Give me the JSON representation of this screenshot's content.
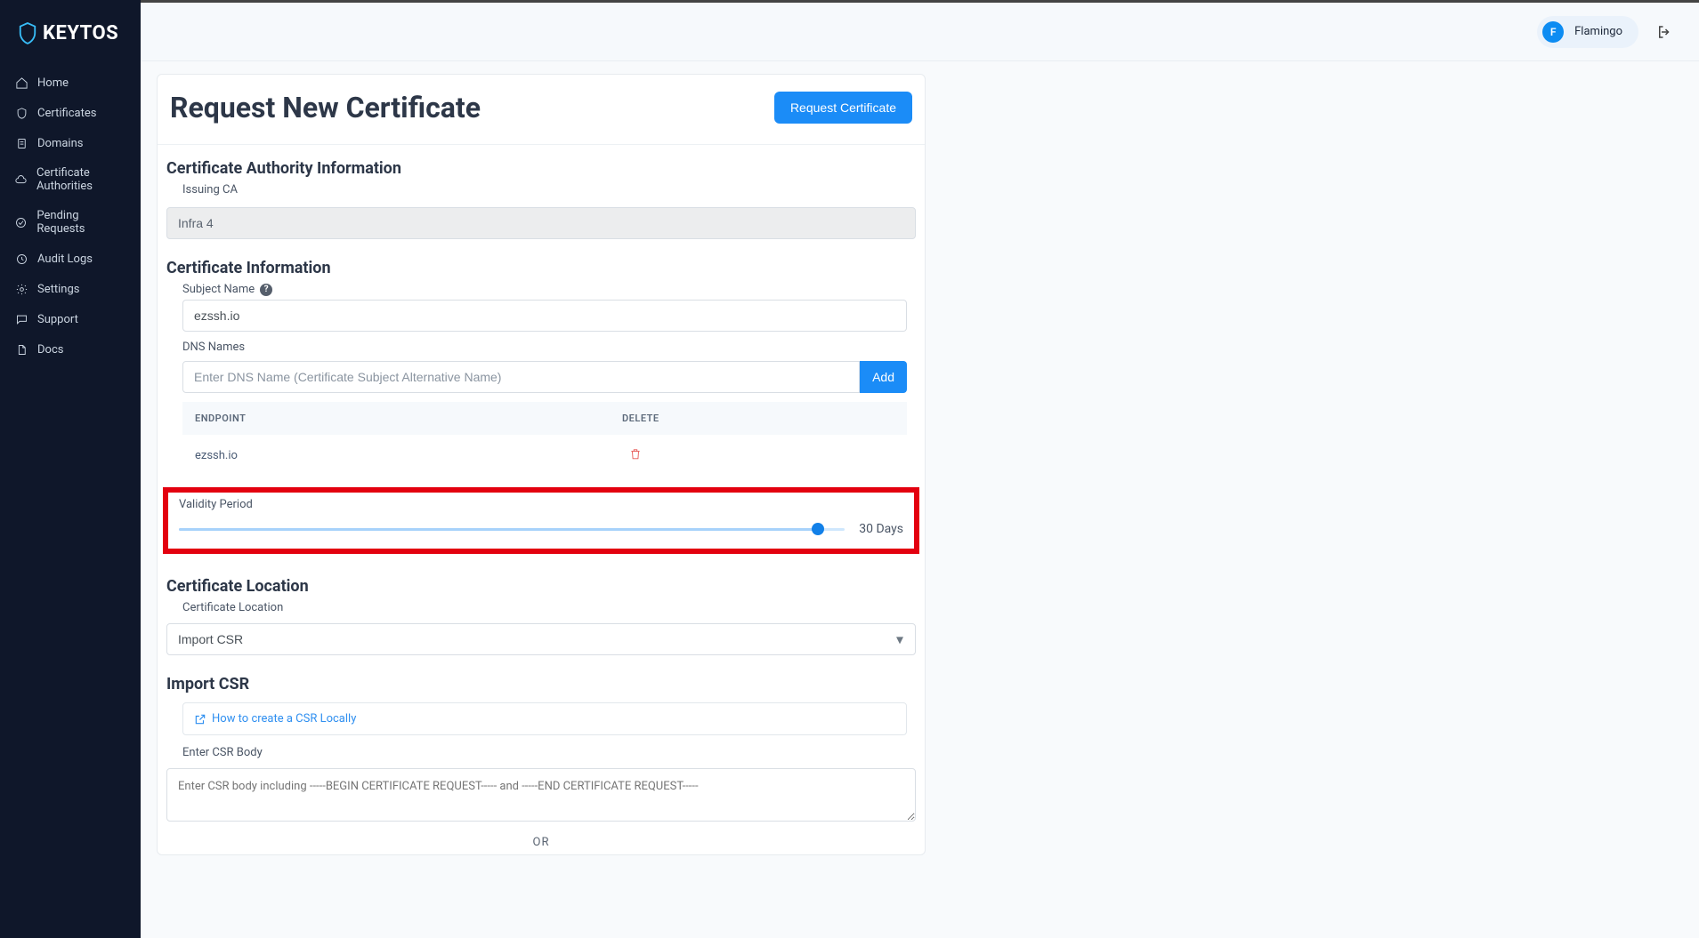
{
  "brand": {
    "name": "KEYTOS"
  },
  "nav": {
    "home": "Home",
    "certificates": "Certificates",
    "domains": "Domains",
    "cas": "Certificate Authorities",
    "pending": "Pending Requests",
    "audit": "Audit Logs",
    "settings": "Settings",
    "support": "Support",
    "docs": "Docs"
  },
  "user": {
    "initial": "F",
    "name": "Flamingo"
  },
  "page": {
    "title": "Request New Certificate",
    "submit_label": "Request Certificate"
  },
  "ca_section": {
    "title": "Certificate Authority Information",
    "issuing_ca_label": "Issuing CA",
    "issuing_ca_value": "Infra 4"
  },
  "cert_section": {
    "title": "Certificate Information",
    "subject_label": "Subject Name",
    "subject_value": "ezssh.io",
    "dns_label": "DNS Names",
    "dns_placeholder": "Enter DNS Name (Certificate Subject Alternative Name)",
    "add_label": "Add",
    "table": {
      "col_endpoint": "ENDPOINT",
      "col_delete": "DELETE",
      "rows": [
        {
          "endpoint": "ezssh.io"
        }
      ]
    },
    "validity_label": "Validity Period",
    "validity_value": "30 Days",
    "validity_percent": 96
  },
  "location_section": {
    "title": "Certificate Location",
    "label": "Certificate Location",
    "value": "Import CSR"
  },
  "csr_section": {
    "title": "Import CSR",
    "help_link": "How to create a CSR Locally",
    "body_label": "Enter CSR Body",
    "body_placeholder": "Enter CSR body including -----BEGIN CERTIFICATE REQUEST----- and -----END CERTIFICATE REQUEST-----",
    "or": "OR"
  }
}
